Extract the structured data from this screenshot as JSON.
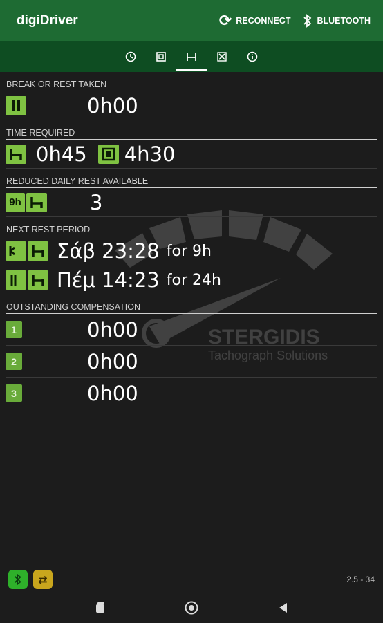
{
  "appbar": {
    "title": "digiDriver",
    "reconnect_label": "RECONNECT",
    "bluetooth_label": "BLUETOOTH"
  },
  "tabs": [
    {
      "icon": "clock-icon"
    },
    {
      "icon": "work-icon"
    },
    {
      "icon": "rest-bed-icon",
      "active": true
    },
    {
      "icon": "tools-icon"
    },
    {
      "icon": "info-icon"
    }
  ],
  "sections": {
    "break_rest": {
      "title": "BREAK OR REST TAKEN",
      "value": "0h00"
    },
    "time_required": {
      "title": "TIME REQUIRED",
      "rest_value": "0h45",
      "work_value": "4h30"
    },
    "reduced_rest": {
      "title": "REDUCED DAILY REST AVAILABLE",
      "badge": "9h",
      "value": "3"
    },
    "next_rest": {
      "title": "NEXT REST PERIOD",
      "rows": [
        {
          "day_time": "Σάβ 23:28",
          "duration": "for 9h"
        },
        {
          "day_time": "Πέμ 14:23",
          "duration": "for 24h"
        }
      ]
    },
    "compensation": {
      "title": "OUTSTANDING COMPENSATION",
      "rows": [
        {
          "number": "1",
          "value": "0h00"
        },
        {
          "number": "2",
          "value": "0h00"
        },
        {
          "number": "3",
          "value": "0h00"
        }
      ]
    }
  },
  "watermark": {
    "brand": "STERGIDIS",
    "tagline": "Tachograph Solutions"
  },
  "footer": {
    "version": "2.5 - 34"
  },
  "colors": {
    "appbar": "#1e6b33",
    "tabbar": "#0e4d22",
    "symbol": "#7fc242",
    "background": "#1c1c1c"
  }
}
